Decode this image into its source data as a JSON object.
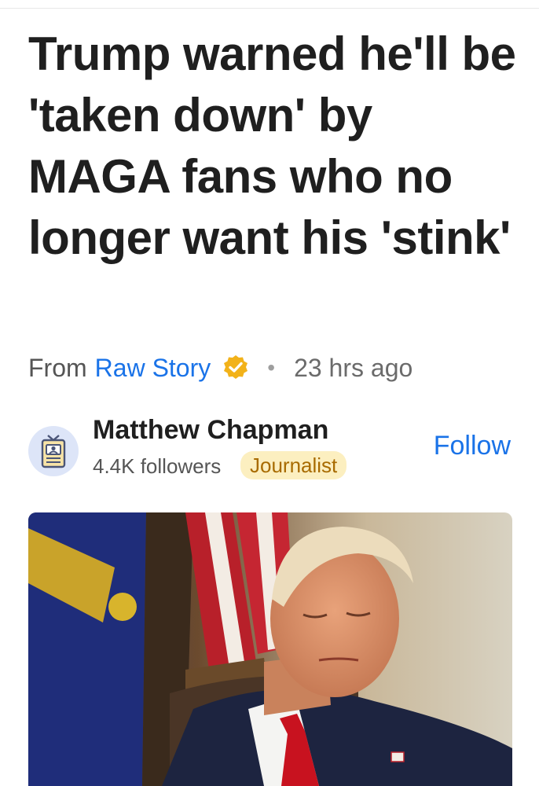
{
  "article": {
    "headline": "Trump warned he'll be 'taken down' by MAGA fans who no longer want his 'stink'",
    "from_label": "From",
    "source": "Raw Story",
    "separator": "•",
    "time_ago": "23 hrs ago"
  },
  "author": {
    "name": "Matthew Chapman",
    "followers": "4.4K followers",
    "badge": "Journalist",
    "follow_label": "Follow"
  },
  "colors": {
    "link_blue": "#1a73e8",
    "badge_bg": "#fcefc0",
    "badge_text": "#a86b00",
    "verified_gold": "#f2b21a"
  },
  "icons": {
    "verified": "verified-badge-icon",
    "author_avatar": "id-badge-icon"
  }
}
